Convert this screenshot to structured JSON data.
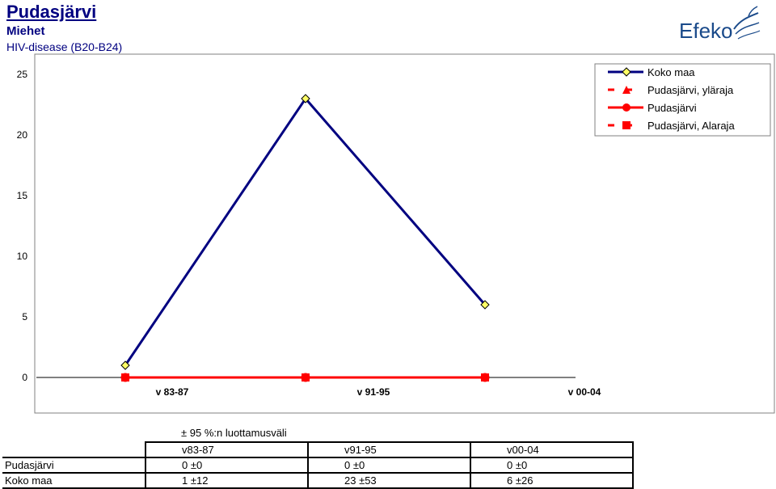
{
  "header": {
    "title": "Pudasjärvi",
    "subtitle1": "Miehet",
    "subtitle2": "HIV-disease (B20-B24)"
  },
  "logo": {
    "text": "Efeko",
    "color": "#1a4a8a"
  },
  "colors": {
    "koko_maa_line": "#000080",
    "koko_maa_marker": "#ffff66",
    "pudasjarvi": "#ff0000",
    "plot_border": "#808080"
  },
  "chart_data": {
    "type": "line",
    "categories": [
      "v 83-87",
      "v 91-95",
      "v 00-04"
    ],
    "ylim": [
      0,
      25
    ],
    "yticks": [
      0,
      5,
      10,
      15,
      20,
      25
    ],
    "grid": false,
    "legend_position": "top-right",
    "series": [
      {
        "name": "Koko maa",
        "values": [
          1,
          23,
          6
        ],
        "color": "#000080",
        "marker": "diamond",
        "style": "solid"
      },
      {
        "name": "Pudasjärvi, yläraja",
        "values": [
          0,
          0,
          0
        ],
        "color": "#ff0000",
        "marker": "triangle",
        "style": "dashed"
      },
      {
        "name": "Pudasjärvi",
        "values": [
          0,
          0,
          0
        ],
        "color": "#ff0000",
        "marker": "circle",
        "style": "solid"
      },
      {
        "name": "Pudasjärvi, Alaraja",
        "values": [
          0,
          0,
          0
        ],
        "color": "#ff0000",
        "marker": "square",
        "style": "dashed"
      }
    ]
  },
  "table": {
    "caption": "± 95 %:n luottamusväli",
    "columns": [
      "v83-87",
      "v91-95",
      "v00-04"
    ],
    "rows": [
      {
        "label": "Pudasjärvi",
        "cells": [
          "0 ±0",
          "0 ±0",
          "0 ±0"
        ]
      },
      {
        "label": "Koko maa",
        "cells": [
          "1 ±12",
          "23 ±53",
          "6 ±26"
        ]
      }
    ]
  }
}
